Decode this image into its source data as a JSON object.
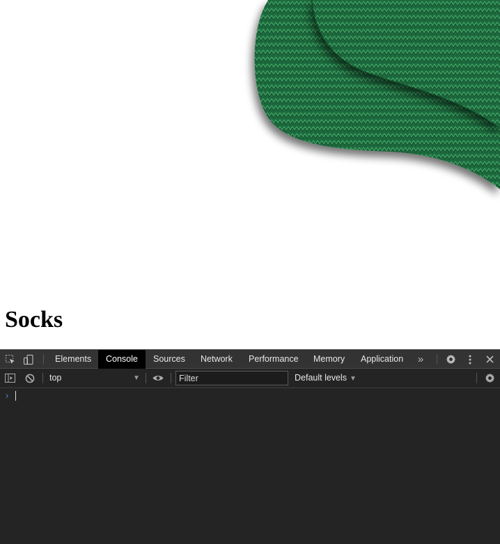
{
  "page": {
    "title": "Socks"
  },
  "devtools": {
    "tabs": [
      {
        "label": "Elements"
      },
      {
        "label": "Console"
      },
      {
        "label": "Sources"
      },
      {
        "label": "Network"
      },
      {
        "label": "Performance"
      },
      {
        "label": "Memory"
      },
      {
        "label": "Application"
      }
    ],
    "active_tab": "Console",
    "more_tabs_icon": "chevron-double-right-icon",
    "toolbar": {
      "context": "top",
      "filter_placeholder": "Filter",
      "levels": "Default levels"
    },
    "colors": {
      "panel_bg": "#242424",
      "tabbar_bg": "#333333",
      "active_tab_bg": "#000000",
      "prompt": "#3d8fd8"
    }
  }
}
